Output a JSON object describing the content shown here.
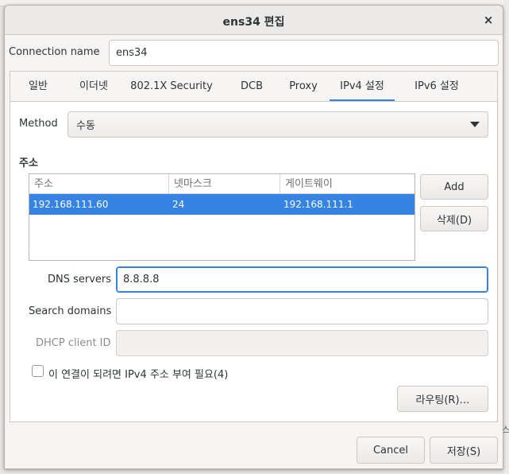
{
  "window": {
    "title": "ens34 편집",
    "close_icon": "×"
  },
  "connection": {
    "label": "Connection name",
    "value": "ens34"
  },
  "tabs": [
    {
      "label": "일반"
    },
    {
      "label": "이더넷"
    },
    {
      "label": "802.1X Security"
    },
    {
      "label": "DCB"
    },
    {
      "label": "Proxy"
    },
    {
      "label": "IPv4 설정",
      "active": true
    },
    {
      "label": "IPv6 설정"
    }
  ],
  "ipv4": {
    "method_label": "Method",
    "method_value": "수동",
    "addresses_heading": "주소",
    "columns": [
      "주소",
      "넷마스크",
      "게이트웨이"
    ],
    "rows": [
      {
        "address": "192.168.111.60",
        "netmask": "24",
        "gateway": "192.168.111.1"
      }
    ],
    "add_label": "Add",
    "delete_label": "삭제(D)",
    "dns_label": "DNS servers",
    "dns_value": "8.8.8.8",
    "search_label": "Search domains",
    "search_value": "",
    "dhcp_label": "DHCP client ID",
    "dhcp_value": "",
    "require_label": "이 연결이 되려면 IPv4 주소 부여 필요(4)",
    "require_checked": false,
    "routes_label": "라우팅(R)…"
  },
  "footer": {
    "cancel_label": "Cancel",
    "save_label": "저장(S)"
  },
  "background": {
    "edge_text": "스"
  },
  "colors": {
    "accent": "#3584e4",
    "selection_text": "#ffffff"
  }
}
